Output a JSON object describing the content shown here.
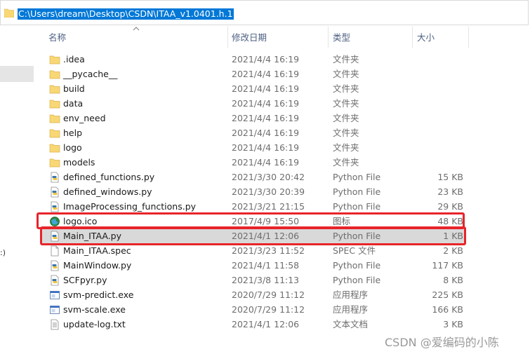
{
  "address": {
    "path": "C:\\Users\\dream\\Desktop\\CSDN\\ITAA_v1.0401.h.1"
  },
  "left_pane": {
    "fragment": ":)"
  },
  "columns": {
    "name": "名称",
    "date": "修改日期",
    "type": "类型",
    "size": "大小"
  },
  "files": [
    {
      "name": ".idea",
      "date": "2021/4/4 16:19",
      "type": "文件夹",
      "size": "",
      "icon": "folder-icon"
    },
    {
      "name": "__pycache__",
      "date": "2021/4/4 16:19",
      "type": "文件夹",
      "size": "",
      "icon": "folder-icon"
    },
    {
      "name": "build",
      "date": "2021/4/4 16:19",
      "type": "文件夹",
      "size": "",
      "icon": "folder-icon"
    },
    {
      "name": "data",
      "date": "2021/4/4 16:19",
      "type": "文件夹",
      "size": "",
      "icon": "folder-icon"
    },
    {
      "name": "env_need",
      "date": "2021/4/4 16:19",
      "type": "文件夹",
      "size": "",
      "icon": "folder-icon"
    },
    {
      "name": "help",
      "date": "2021/4/4 16:19",
      "type": "文件夹",
      "size": "",
      "icon": "folder-icon"
    },
    {
      "name": "logo",
      "date": "2021/4/4 16:19",
      "type": "文件夹",
      "size": "",
      "icon": "folder-icon"
    },
    {
      "name": "models",
      "date": "2021/4/4 16:19",
      "type": "文件夹",
      "size": "",
      "icon": "folder-icon"
    },
    {
      "name": "defined_functions.py",
      "date": "2021/3/30 20:42",
      "type": "Python File",
      "size": "15 KB",
      "icon": "python-file-icon"
    },
    {
      "name": "defined_windows.py",
      "date": "2021/3/30 20:39",
      "type": "Python File",
      "size": "23 KB",
      "icon": "python-file-icon"
    },
    {
      "name": "ImageProcessing_functions.py",
      "date": "2021/3/21 21:15",
      "type": "Python File",
      "size": "29 KB",
      "icon": "python-file-icon"
    },
    {
      "name": "logo.ico",
      "date": "2017/4/9 15:50",
      "type": "图标",
      "size": "48 KB",
      "icon": "ico-file-icon"
    },
    {
      "name": "Main_ITAA.py",
      "date": "2021/4/1 12:06",
      "type": "Python File",
      "size": "1 KB",
      "icon": "python-file-icon"
    },
    {
      "name": "Main_ITAA.spec",
      "date": "2021/3/23 11:52",
      "type": "SPEC 文件",
      "size": "2 KB",
      "icon": "blank-file-icon"
    },
    {
      "name": "MainWindow.py",
      "date": "2021/4/1 11:58",
      "type": "Python File",
      "size": "117 KB",
      "icon": "python-file-icon"
    },
    {
      "name": "SCFpyr.py",
      "date": "2021/3/8 11:13",
      "type": "Python File",
      "size": "8 KB",
      "icon": "python-file-icon"
    },
    {
      "name": "svm-predict.exe",
      "date": "2020/7/29 11:12",
      "type": "应用程序",
      "size": "225 KB",
      "icon": "exe-file-icon"
    },
    {
      "name": "svm-scale.exe",
      "date": "2020/7/29 11:12",
      "type": "应用程序",
      "size": "166 KB",
      "icon": "exe-file-icon"
    },
    {
      "name": "update-log.txt",
      "date": "2021/4/1 12:06",
      "type": "文本文档",
      "size": "3 KB",
      "icon": "text-file-icon"
    }
  ],
  "watermark": "CSDN @爱编码的小陈",
  "colors": {
    "highlight": "#e8242a",
    "selection": "#0078d7",
    "folder": "#f8d775"
  }
}
